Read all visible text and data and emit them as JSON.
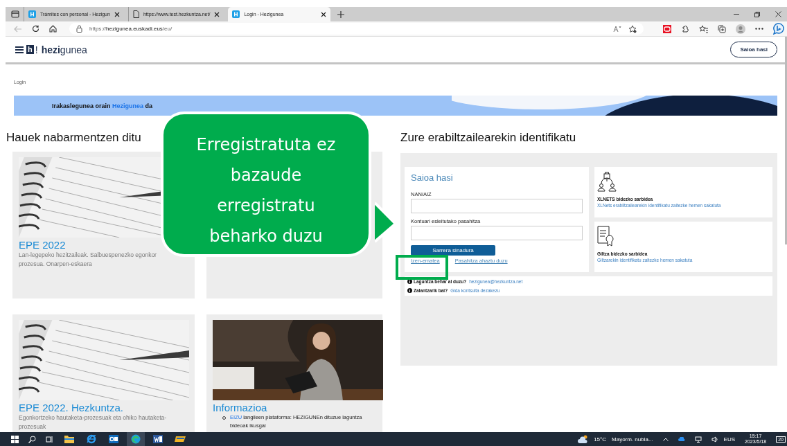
{
  "browser": {
    "tabs": [
      {
        "title": "Trámites con personal - Hezigun",
        "kind": "site",
        "selected": false
      },
      {
        "title": "https://www.test.hezkuntza.net/",
        "kind": "page",
        "selected": false
      },
      {
        "title": "Login - Hezigunea",
        "kind": "site",
        "selected": true
      }
    ],
    "address_prefix": "https://",
    "address_host": "hezigunea.euskadi.eus",
    "address_path": "/eu/"
  },
  "header": {
    "logo_mark": "h",
    "logo_suffix": "!",
    "logo_name": "**hezi**gunea",
    "login_button": "Saioa hasi"
  },
  "breadcrumb": "Login",
  "banner": {
    "text": "Irakaslegunea orain",
    "link": "Hezigunea",
    "after": "da"
  },
  "featured": {
    "heading": "Hauek nabarmentzen ditu",
    "cards": [
      {
        "kind": "notebook",
        "title": "EPE 2022",
        "description": "Lan-legepeko hezitzaileak. Salbuespenezko egonkor prozesua. Onarpen-eskaera"
      },
      {
        "kind": "notebook",
        "title": "EPE 2022. Hezkuntza.",
        "description": "Egonkortzeko hautaketa-prozesuak eta ohiko hautaketa-prozesuak"
      },
      {
        "title": "Informazioa",
        "bullets": [
          {
            "link": "EIZU",
            "text": "langileen plataforma: HEZIGUNEn dituzue laguntza bideoak ikusgai"
          }
        ]
      }
    ]
  },
  "login": {
    "heading": "Zure erabiltzailearekin identifikatu",
    "title": "Saioa hasi",
    "fields": [
      {
        "label": "NAN/AIZ"
      },
      {
        "label": "Kontuari esleitutako pasahitza"
      }
    ],
    "submit": "Sarrera sinadura",
    "links": [
      "Izen-ematea",
      "Pasahitza ahaztu duzu"
    ],
    "access": [
      {
        "kind": "xlnets",
        "title": "XLNETS bidezko sarbidea",
        "link": "XLNets erabiltzailearekin identifikatu zaitezke hemen sakatuta"
      },
      {
        "kind": "giltza",
        "title": "Giltza bidezko sarbidea",
        "link": "Giltzarekin identifikatu zaitezke hemen sakatuta"
      }
    ],
    "help": [
      {
        "question": "Laguntza behar al duzu?",
        "link": "hezigunea@hezkuntza.net"
      },
      {
        "question": "Zalantzarik bai?",
        "link": "Gida kontsulta dezakezu"
      }
    ]
  },
  "callout": {
    "text": "Erregistratuta ez bazaude erregistratu beharko duzu"
  },
  "taskbar": {
    "apps": [
      {
        "kind": "folder",
        "selected": false
      },
      {
        "kind": "ie",
        "selected": false
      },
      {
        "kind": "outlook",
        "selected": false
      },
      {
        "kind": "edge",
        "selected": true
      },
      {
        "kind": "word",
        "selected": false
      },
      {
        "kind": "app",
        "selected": false
      }
    ],
    "temperature": "15°C",
    "weather": "Mayorm. nubla...",
    "language": "EUS",
    "time": "15:17",
    "date": "2023/5/18",
    "notifications": "20"
  }
}
